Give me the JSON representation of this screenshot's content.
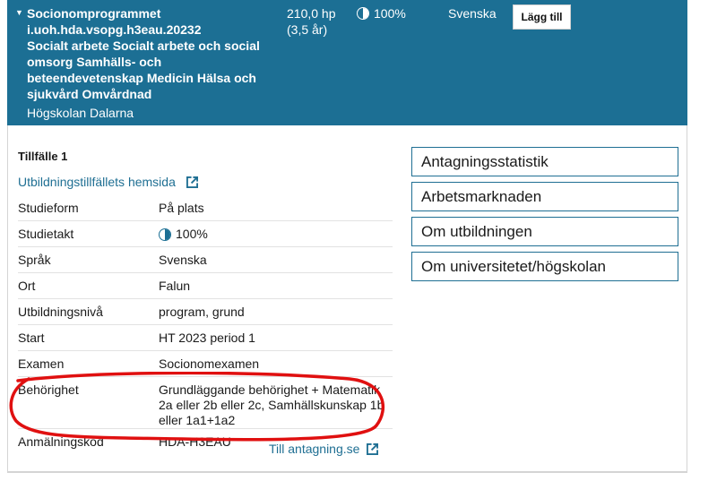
{
  "header": {
    "title": "Socionomprogrammet",
    "code": "i.uoh.hda.vsopg.h3eau.20232",
    "subjects": "Socialt arbete Socialt arbete och social omsorg Samhälls- och beteendevetenskap Medicin Hälsa och sjukvård Omvårdnad",
    "school": "Högskolan Dalarna",
    "credits": "210,0 hp",
    "duration": "(3,5 år)",
    "pace": "100%",
    "language": "Svenska",
    "add_button": "Lägg till"
  },
  "occasion": {
    "title": "Tillfälle 1",
    "homepage_link": "Utbildningstillfällets hemsida",
    "rows": [
      {
        "label": "Studieform",
        "value": "På plats"
      },
      {
        "label": "Studietakt",
        "value": "100%"
      },
      {
        "label": "Språk",
        "value": "Svenska"
      },
      {
        "label": "Ort",
        "value": "Falun"
      },
      {
        "label": "Utbildningsnivå",
        "value": "program, grund"
      },
      {
        "label": "Start",
        "value": "HT 2023 period 1"
      },
      {
        "label": "Examen",
        "value": "Socionomexamen"
      },
      {
        "label": "Behörighet",
        "value": "Grundläggande behörighet + Matematik 2a eller 2b eller 2c, Samhällskunskap 1b eller 1a1+1a2"
      },
      {
        "label": "Anmälningskod",
        "value": "HDA-H3EAU"
      }
    ],
    "apply_link": "Till antagning.se"
  },
  "side_links": [
    "Antagningsstatistik",
    "Arbetsmarknaden",
    "Om utbildningen",
    "Om universitetet/högskolan"
  ],
  "colors": {
    "header_bg": "#1c6f94",
    "link": "#1f6f93",
    "highlight": "#e01010"
  },
  "icons": {
    "expand": "caret-down-icon",
    "pace": "half-circle-icon",
    "external": "external-link-icon"
  }
}
